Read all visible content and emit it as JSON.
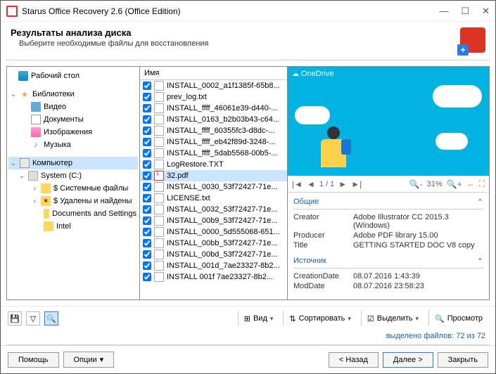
{
  "titlebar": {
    "title": "Starus Office Recovery 2.6 (Office Edition)"
  },
  "header": {
    "title": "Результаты анализа диска",
    "subtitle": "Выберите необходимые файлы для восстановления"
  },
  "tree": {
    "desktop": "Рабочий стол",
    "libraries": "Библиотеки",
    "video": "Видео",
    "documents": "Документы",
    "images": "Изображения",
    "music": "Музыка",
    "computer": "Компьютер",
    "system_c": "System (C:)",
    "sys_files": "$ Системные файлы",
    "deleted_found": "$ Удалены и найдены",
    "docs_settings": "Documents and Settings",
    "intel": "Intel"
  },
  "filecol": {
    "header": "Имя",
    "items": [
      "INSTALL_0002_a1f1385f-65b8...",
      "prev_log.txt",
      "INSTALL_ffff_46061e39-d440-...",
      "INSTALL_0163_b2b03b43-c64...",
      "INSTALL_ffff_60355fc3-d8dc-...",
      "INSTALL_ffff_eb42f89d-3248-...",
      "INSTALL_ffff_5dab5568-00b5-...",
      "LogRestore.TXT",
      "32.pdf",
      "INSTALL_0030_53f72427-71e...",
      "LICENSE.txt",
      "INSTALL_0032_53f72427-71e...",
      "INSTALL_00b9_53f72427-71e...",
      "INSTALL_0000_5d555068-651...",
      "INSTALL_00bb_53f72427-71e...",
      "INSTALL_00bd_53f72427-71e...",
      "INSTALL_001d_7ae23327-8b2...",
      "INSTALL  001f  7ae23327-8b2..."
    ],
    "selected_index": 8,
    "pdf_index": 8
  },
  "preview": {
    "banner": "OneDrive",
    "nav": {
      "page": "1 / 1",
      "zoom": "31%"
    },
    "section1": "Общие",
    "section2": "Источник",
    "creator_k": "Creator",
    "creator_v": "Adobe Illustrator CC 2015.3 (Windows)",
    "producer_k": "Producer",
    "producer_v": "Adobe PDF library 15.00",
    "title_k": "Title",
    "title_v": "GETTING STARTED DOC V8 copy",
    "cdate_k": "CreationDate",
    "cdate_v": "08.07.2016 1:43:39",
    "mdate_k": "ModDate",
    "mdate_v": "08.07.2016 23:58:23"
  },
  "toolbar2": {
    "view": "Вид",
    "sort": "Сортировать",
    "select": "Выделить",
    "preview": "Просмотр"
  },
  "status": {
    "label": "выделено файлов: ",
    "count": "72 из 72"
  },
  "footer": {
    "help": "Помощь",
    "options": "Опции",
    "back": "< Назад",
    "next": "Далее >",
    "close": "Закрыть"
  }
}
